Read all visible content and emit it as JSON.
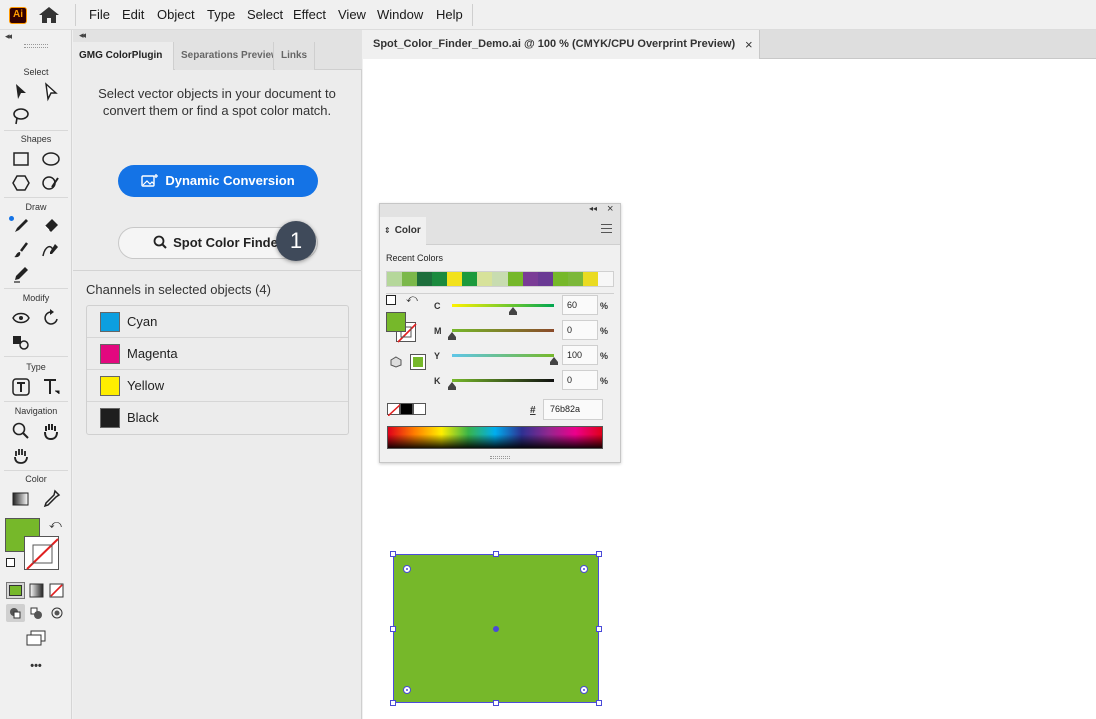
{
  "app": {
    "logo_text": "Ai"
  },
  "menu": [
    "File",
    "Edit",
    "Object",
    "Type",
    "Select",
    "Effect",
    "View",
    "Window",
    "Help"
  ],
  "toolbar": {
    "sections": [
      "Select",
      "Shapes",
      "Draw",
      "Modify",
      "Type",
      "Navigation",
      "Color"
    ],
    "more_label": "•••",
    "fill_color": "#76b82a"
  },
  "plugin_panel": {
    "tabs": [
      "GMG ColorPlugin",
      "Separations Preview",
      "Links"
    ],
    "message": "Select vector objects in your document to convert them or find a spot color match.",
    "dynamic_button": "Dynamic Conversion",
    "spot_button": "Spot Color Finder",
    "badge": "1",
    "channels_title": "Channels in selected objects (4)",
    "channels": [
      {
        "name": "Cyan",
        "color": "#0c9fe0"
      },
      {
        "name": "Magenta",
        "color": "#e3087f"
      },
      {
        "name": "Yellow",
        "color": "#ffee00"
      },
      {
        "name": "Black",
        "color": "#1e1e1e"
      }
    ]
  },
  "document": {
    "tab_title": "Spot_Color_Finder_Demo.ai @ 100 % (CMYK/CPU Overprint Preview)",
    "close_glyph": "×",
    "object_color": "#76b82a"
  },
  "color_panel": {
    "tab_label": "Color",
    "recent_label": "Recent Colors",
    "recent_colors": [
      "#b5d79a",
      "#7bb84a",
      "#1e6e3c",
      "#1b8a3e",
      "#f2e21c",
      "#1c9a3c",
      "#d7e29a",
      "#c8dcb0",
      "#76b82a",
      "#7a3c96",
      "#6a3a94",
      "#76b82a",
      "#7cb83a",
      "#eadb22",
      "#f7f7f7"
    ],
    "sliders": [
      {
        "label": "C",
        "value": "60",
        "gradient": "linear-gradient(to right,#fff200,#00a651)",
        "level": 0.6
      },
      {
        "label": "M",
        "value": "0",
        "gradient": "linear-gradient(to right,#76b82a,#8b4a2a)",
        "level": 0
      },
      {
        "label": "Y",
        "value": "100",
        "gradient": "linear-gradient(to right,#5fc6e8,#76b82a)",
        "level": 1
      },
      {
        "label": "K",
        "value": "0",
        "gradient": "linear-gradient(to right,#76b82a,#111)",
        "level": 0
      }
    ],
    "percent": "%",
    "hex_prefix": "#",
    "hex_value": "76b82a",
    "fill": "#76b82a"
  }
}
